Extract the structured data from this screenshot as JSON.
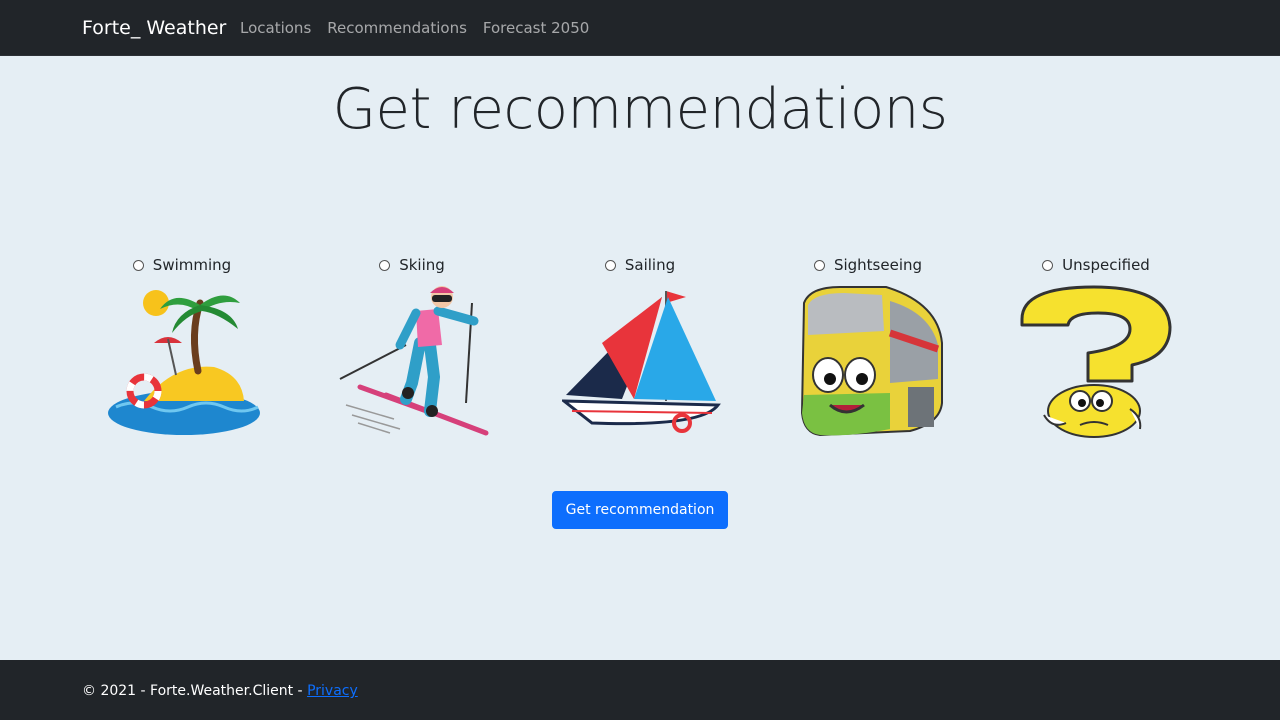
{
  "navbar": {
    "brand": "Forte_ Weather",
    "links": [
      "Locations",
      "Recommendations",
      "Forecast 2050"
    ]
  },
  "page": {
    "title": "Get recommendations"
  },
  "options": [
    {
      "label": "Swimming",
      "icon": "island-icon"
    },
    {
      "label": "Skiing",
      "icon": "skier-icon"
    },
    {
      "label": "Sailing",
      "icon": "sailboat-icon"
    },
    {
      "label": "Sightseeing",
      "icon": "tour-bus-icon"
    },
    {
      "label": "Unspecified",
      "icon": "question-mark-icon"
    }
  ],
  "button": {
    "label": "Get recommendation"
  },
  "footer": {
    "text": "© 2021 - Forte.Weather.Client - ",
    "link": "Privacy"
  },
  "colors": {
    "navbar_bg": "#212529",
    "page_bg": "#e5eef4",
    "primary": "#0d6efd"
  }
}
